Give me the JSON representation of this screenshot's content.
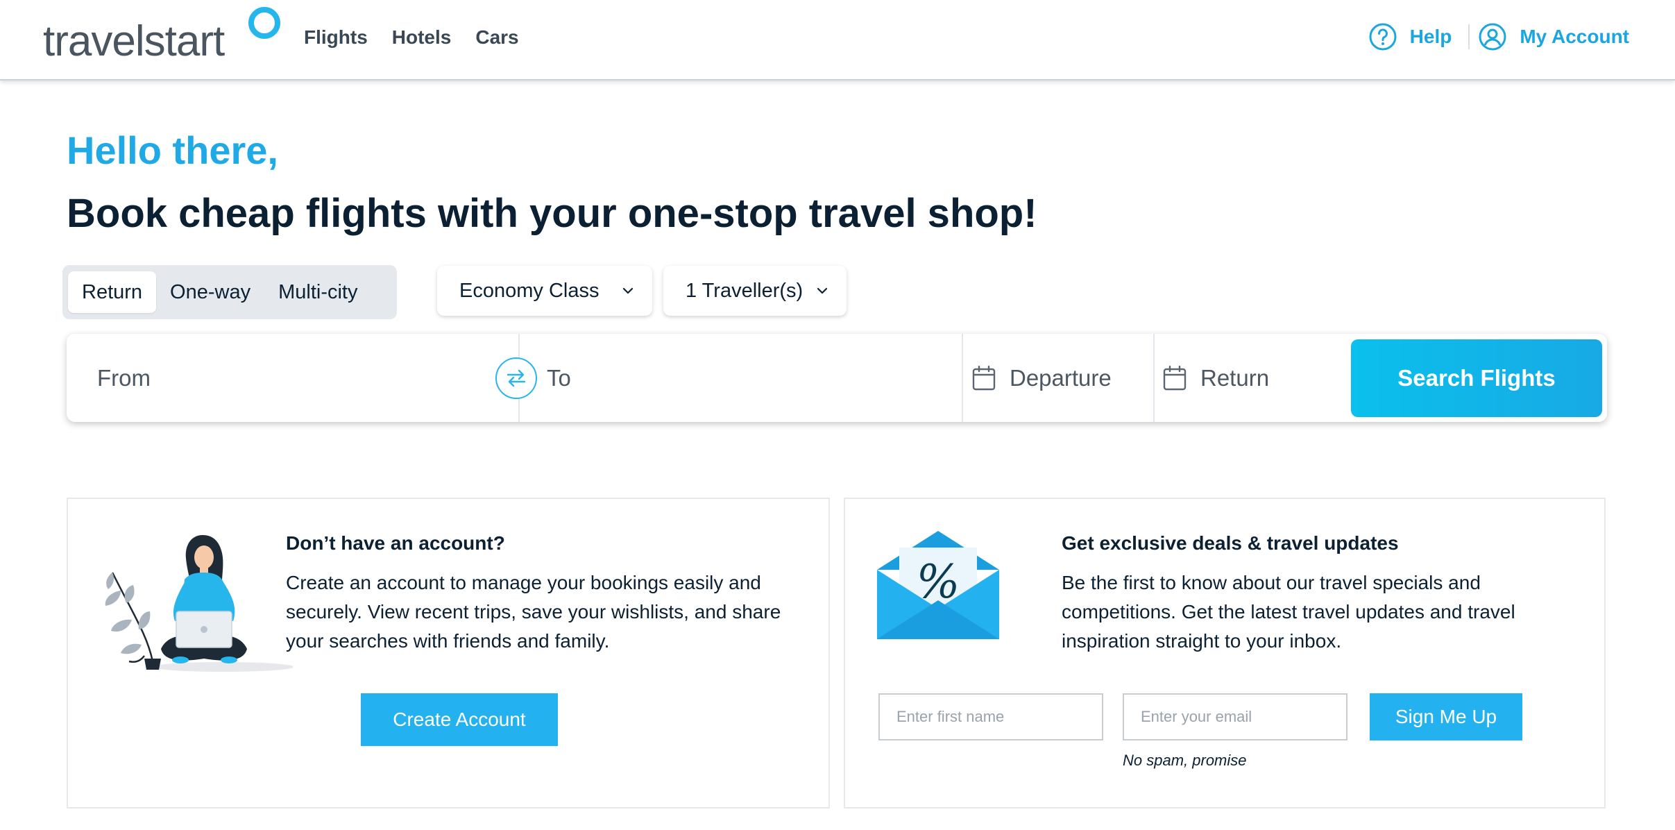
{
  "header": {
    "logo_text": "travelstart",
    "nav": [
      "Flights",
      "Hotels",
      "Cars"
    ],
    "help_label": "Help",
    "account_label": "My Account"
  },
  "hero": {
    "greeting": "Hello there,",
    "headline": "Book cheap flights with your one-stop travel shop!"
  },
  "search": {
    "trip_types": [
      "Return",
      "One-way",
      "Multi-city"
    ],
    "selected_trip_type": "Return",
    "cabin_class": "Economy Class",
    "travellers": "1 Traveller(s)",
    "from_placeholder": "From",
    "to_placeholder": "To",
    "departure_placeholder": "Departure",
    "return_placeholder": "Return",
    "search_button": "Search Flights"
  },
  "account_card": {
    "title": "Don’t have an account?",
    "body": "Create an account to manage your bookings easily and securely. View recent trips, save your wishlists, and share your searches with friends and family.",
    "button": "Create Account"
  },
  "newsletter_card": {
    "title": "Get exclusive deals & travel updates",
    "body": "Be the first to know about our travel specials and competitions. Get the latest travel updates and travel inspiration straight to your inbox.",
    "first_name_placeholder": "Enter first name",
    "email_placeholder": "Enter your email",
    "button": "Sign Me Up",
    "note": "No spam, promise"
  },
  "colors": {
    "brand_blue": "#1fa9e6",
    "dark_text": "#0b2033",
    "button_blue": "#23b1ef"
  }
}
